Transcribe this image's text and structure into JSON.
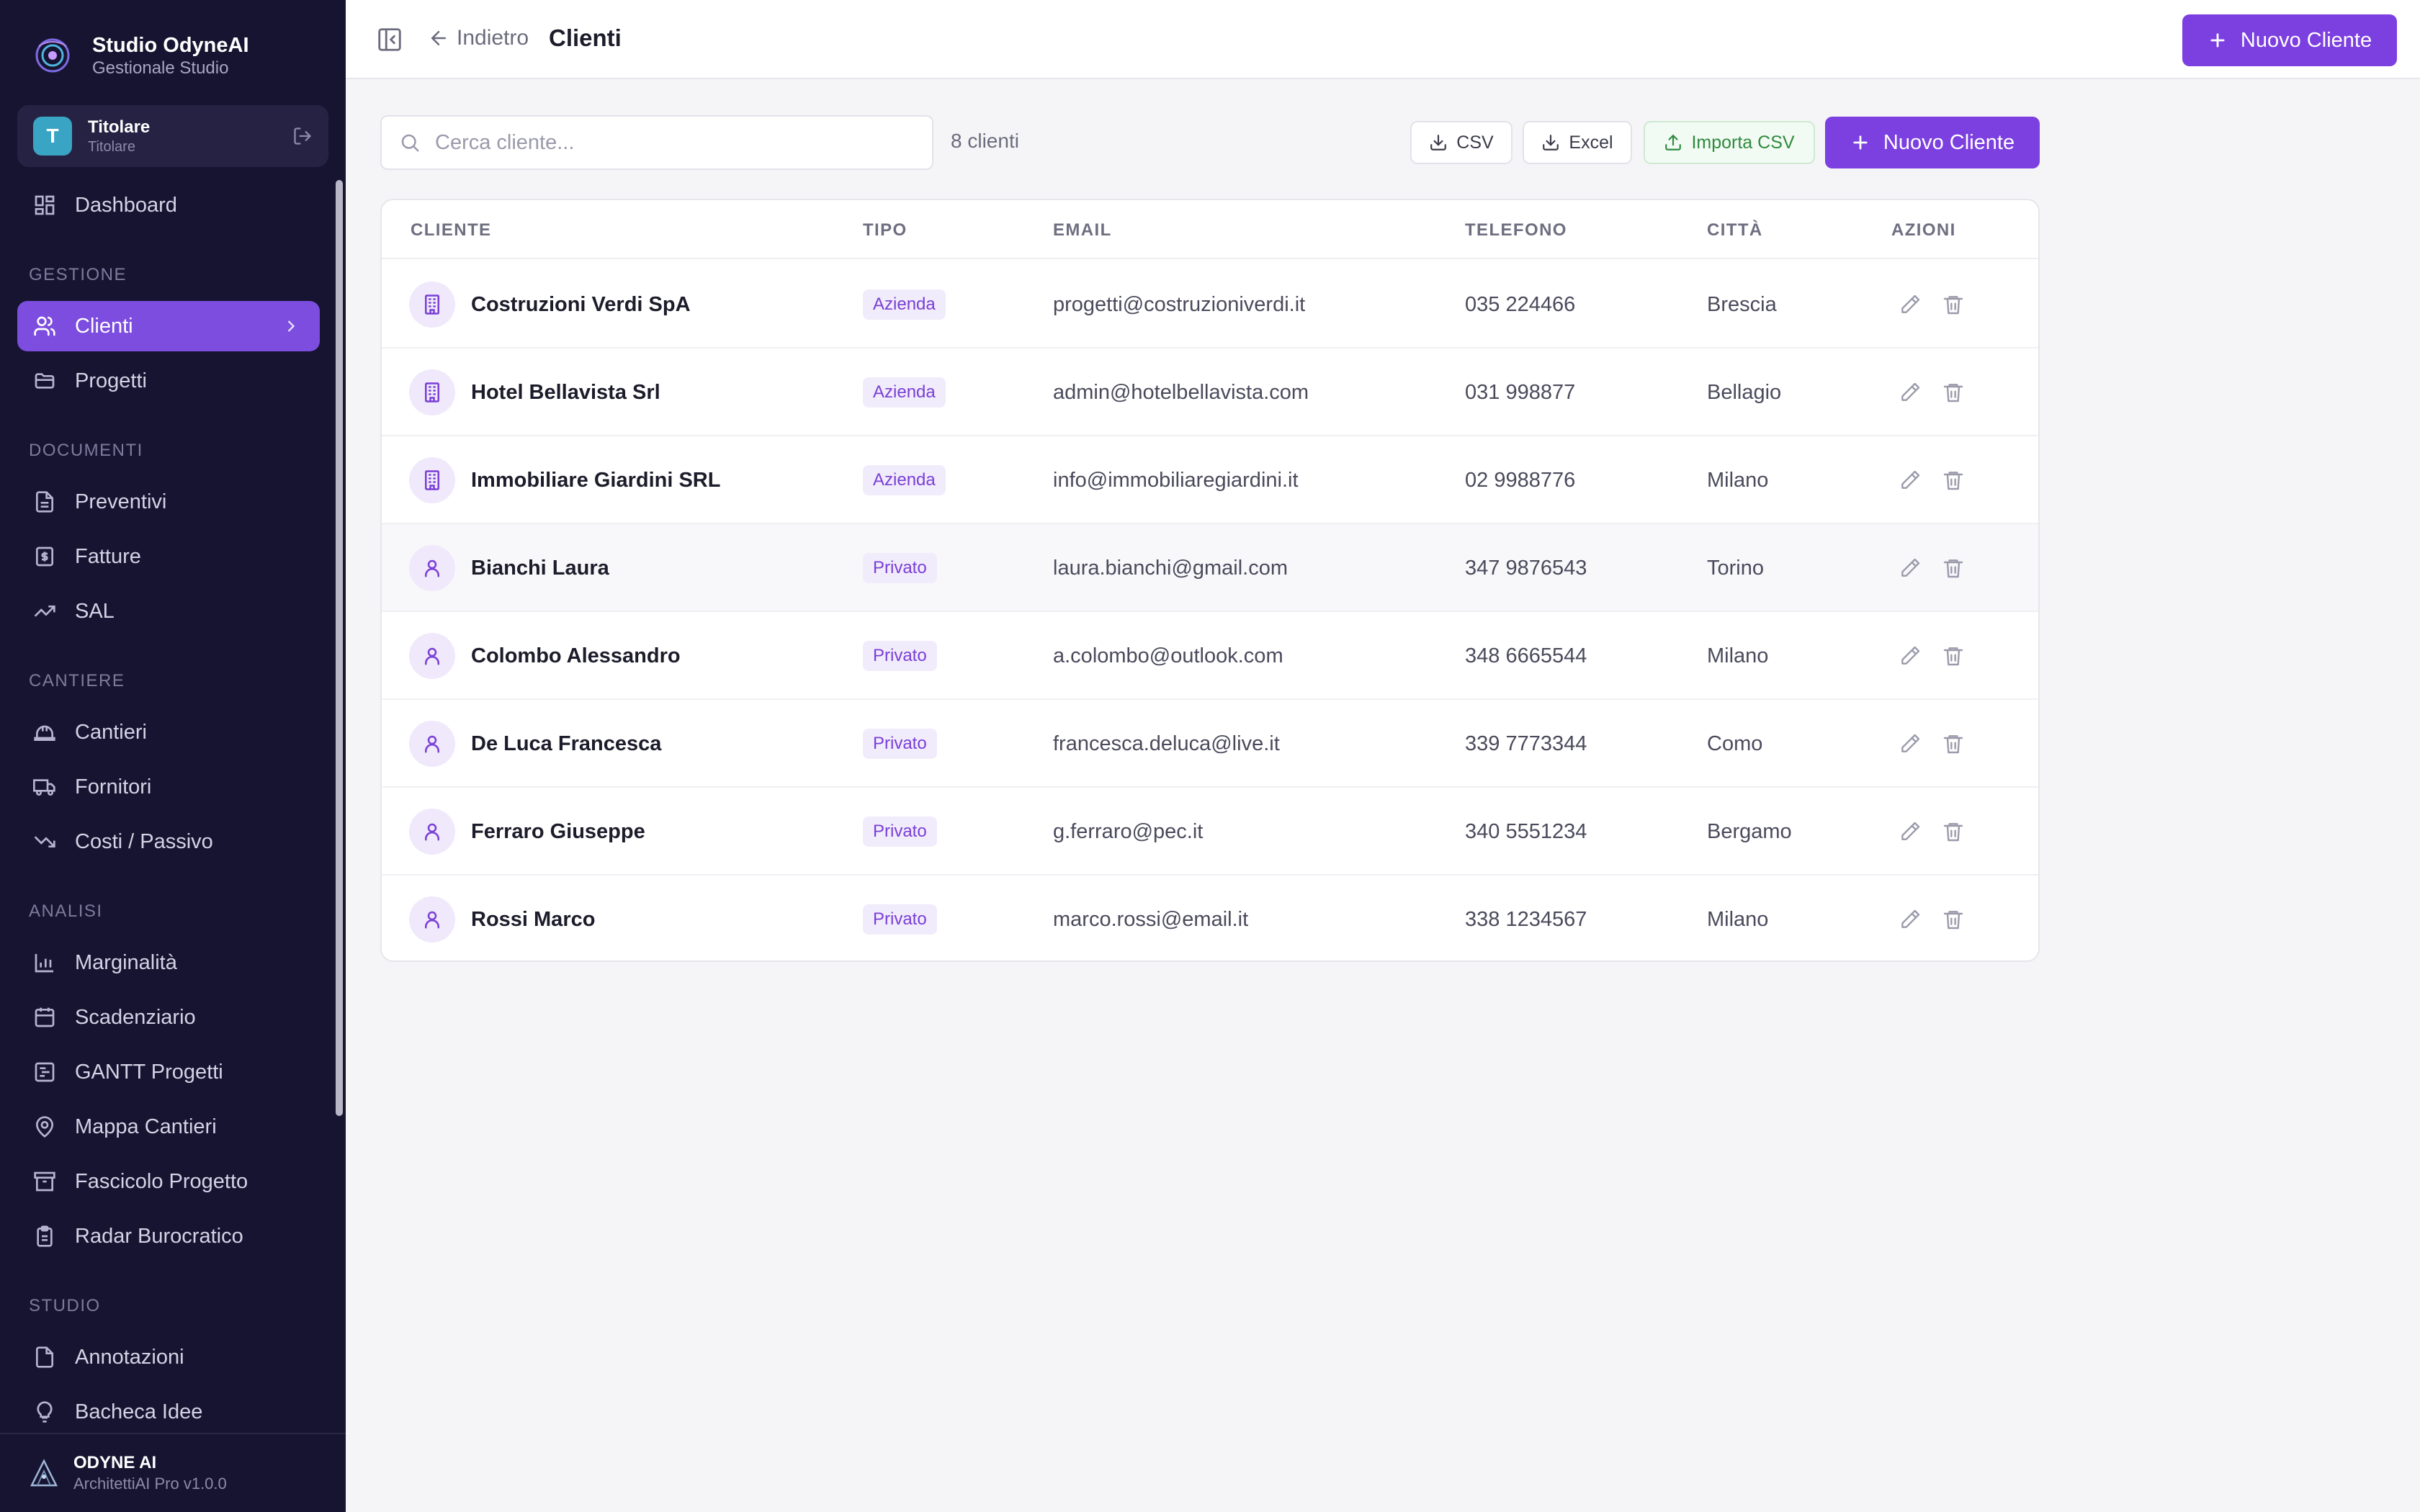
{
  "brand": {
    "name": "Studio OdyneAI",
    "subtitle": "Gestionale Studio"
  },
  "user": {
    "initial": "T",
    "name": "Titolare",
    "role": "Titolare"
  },
  "sidebar": {
    "items": [
      {
        "label": "Dashboard",
        "icon": "dashboard-icon"
      },
      {
        "section": "GESTIONE"
      },
      {
        "label": "Clienti",
        "icon": "users-icon",
        "active": true
      },
      {
        "label": "Progetti",
        "icon": "folder-icon"
      },
      {
        "section": "DOCUMENTI"
      },
      {
        "label": "Preventivi",
        "icon": "document-icon"
      },
      {
        "label": "Fatture",
        "icon": "invoice-icon"
      },
      {
        "label": "SAL",
        "icon": "trend-up-icon"
      },
      {
        "section": "CANTIERE"
      },
      {
        "label": "Cantieri",
        "icon": "hardhat-icon"
      },
      {
        "label": "Fornitori",
        "icon": "truck-icon"
      },
      {
        "label": "Costi / Passivo",
        "icon": "trend-down-icon"
      },
      {
        "section": "ANALISI"
      },
      {
        "label": "Marginalità",
        "icon": "bar-chart-icon"
      },
      {
        "label": "Scadenziario",
        "icon": "calendar-icon"
      },
      {
        "label": "GANTT Progetti",
        "icon": "gantt-icon"
      },
      {
        "label": "Mappa Cantieri",
        "icon": "map-pin-icon"
      },
      {
        "label": "Fascicolo Progetto",
        "icon": "archive-icon"
      },
      {
        "label": "Radar Burocratico",
        "icon": "clipboard-icon"
      },
      {
        "section": "STUDIO"
      },
      {
        "label": "Annotazioni",
        "icon": "note-icon"
      },
      {
        "label": "Bacheca Idee",
        "icon": "lightbulb-icon"
      }
    ]
  },
  "footer": {
    "title": "ODYNE AI",
    "version": "ArchitettiAI Pro v1.0.0"
  },
  "header": {
    "back": "Indietro",
    "title": "Clienti",
    "new_client": "Nuovo Cliente"
  },
  "toolbar": {
    "search_placeholder": "Cerca cliente...",
    "count": "8 clienti",
    "csv": "CSV",
    "excel": "Excel",
    "import_csv": "Importa CSV",
    "new_client": "Nuovo Cliente"
  },
  "table": {
    "columns": [
      "CLIENTE",
      "TIPO",
      "EMAIL",
      "TELEFONO",
      "CITTÀ",
      "AZIONI"
    ],
    "rows": [
      {
        "name": "Costruzioni Verdi SpA",
        "type": "Azienda",
        "email": "progetti@costruzioniverdi.it",
        "phone": "035 224466",
        "city": "Brescia"
      },
      {
        "name": "Hotel Bellavista Srl",
        "type": "Azienda",
        "email": "admin@hotelbellavista.com",
        "phone": "031 998877",
        "city": "Bellagio"
      },
      {
        "name": "Immobiliare Giardini SRL",
        "type": "Azienda",
        "email": "info@immobiliaregiardini.it",
        "phone": "02 9988776",
        "city": "Milano"
      },
      {
        "name": "Bianchi Laura",
        "type": "Privato",
        "email": "laura.bianchi@gmail.com",
        "phone": "347 9876543",
        "city": "Torino"
      },
      {
        "name": "Colombo Alessandro",
        "type": "Privato",
        "email": "a.colombo@outlook.com",
        "phone": "348 6665544",
        "city": "Milano"
      },
      {
        "name": "De Luca Francesca",
        "type": "Privato",
        "email": "francesca.deluca@live.it",
        "phone": "339 7773344",
        "city": "Como"
      },
      {
        "name": "Ferraro Giuseppe",
        "type": "Privato",
        "email": "g.ferraro@pec.it",
        "phone": "340 5551234",
        "city": "Bergamo"
      },
      {
        "name": "Rossi Marco",
        "type": "Privato",
        "email": "marco.rossi@email.it",
        "phone": "338 1234567",
        "city": "Milano"
      }
    ]
  },
  "colors": {
    "accent": "#7c3fe0",
    "sidebar_bg": "#171431",
    "badge_text": "#7a3fd6"
  }
}
